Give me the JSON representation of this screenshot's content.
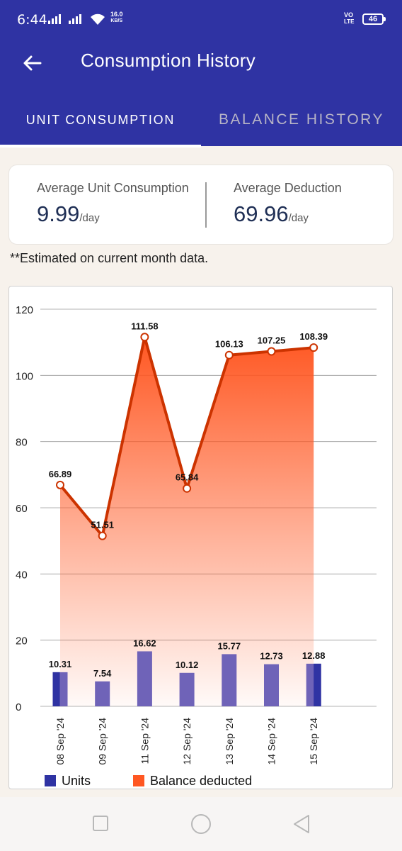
{
  "status_bar": {
    "time": "6:44",
    "net_speed_value": "16.0",
    "net_speed_unit": "KB/S",
    "volte_top": "VO",
    "volte_bottom": "LTE",
    "battery": "46"
  },
  "header": {
    "title": "Consumption History"
  },
  "tabs": [
    {
      "label": "UNIT CONSUMPTION",
      "active": true
    },
    {
      "label": "BALANCE HISTORY",
      "active": false
    }
  ],
  "summary": {
    "avg_unit_label": "Average Unit Consumption",
    "avg_unit_value": "9.99",
    "avg_unit_suffix": "/day",
    "avg_deduction_label": "Average Deduction",
    "avg_deduction_value": "69.96",
    "avg_deduction_suffix": "/day"
  },
  "note": "**Estimated on current month data.",
  "colors": {
    "primary": "#2f33a3",
    "units_bar": "#6f63b8",
    "units_legend": "#2f33a3",
    "balance_line": "#cc3300",
    "balance_fill": "#ff5722"
  },
  "chart_data": {
    "type": "bar+area",
    "categories": [
      "08 Sep '24",
      "09 Sep '24",
      "11 Sep '24",
      "12 Sep '24",
      "13 Sep '24",
      "14 Sep '24",
      "15 Sep '24"
    ],
    "series": [
      {
        "name": "Units",
        "type": "bar",
        "values": [
          10.31,
          7.54,
          16.62,
          10.12,
          15.77,
          12.73,
          12.88
        ]
      },
      {
        "name": "Balance deducted",
        "type": "area",
        "values": [
          66.89,
          51.51,
          111.58,
          65.84,
          106.13,
          107.25,
          108.39
        ]
      }
    ],
    "y_ticks": [
      "0",
      "20",
      "40",
      "60",
      "80",
      "100",
      "120"
    ],
    "ylim": [
      0,
      120
    ],
    "grid": true,
    "legend": "bottom-left"
  }
}
